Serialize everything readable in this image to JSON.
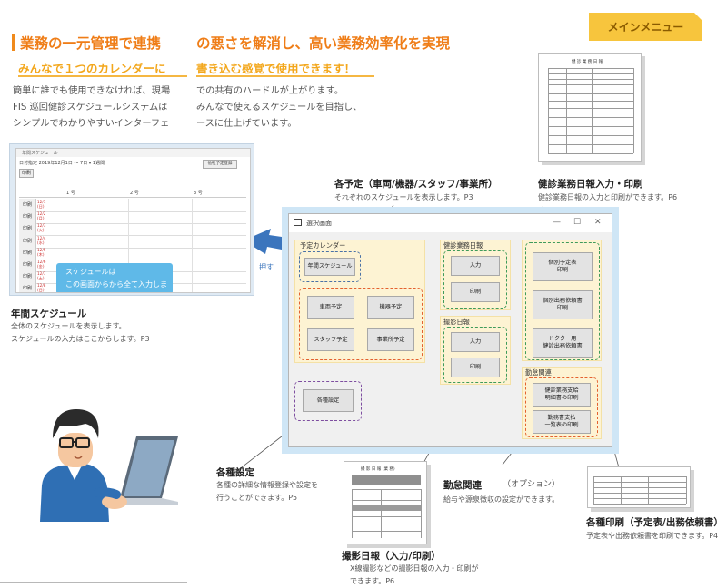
{
  "header": {
    "heading_left": "業務の一元管理で連携",
    "heading_right": "の悪さを解消し、高い業務効率化を実現",
    "subheading_left": "みんなで１つのカレンダーに",
    "subheading_right": "書き込む感覚で使用できます！",
    "intro_left": [
      "簡単に誰でも使用できなければ、現場",
      "FIS 巡回健診スケジュールシステムは",
      "シンプルでわかりやすいインターフェ"
    ],
    "intro_right": [
      "での共有のハードルが上がります。",
      "みんなで使えるスケジュールを目指し、",
      "ースに仕上げています。"
    ]
  },
  "menu_badge": "メインメニュー",
  "annotations": {
    "nenkan": {
      "title": "年間スケジュール",
      "desc": [
        "全体のスケジュールを表示します。",
        "スケジュールの入力はここからします。P3"
      ]
    },
    "kakuyotei": {
      "title": "各予定（車両/機器/スタッフ/事業所）",
      "desc": [
        "それぞれのスケジュールを表示します。P3"
      ]
    },
    "kenshin": {
      "title": "健診業務日報入力・印刷",
      "desc": [
        "健診業務日報の入力と印刷ができます。P6"
      ]
    },
    "settei": {
      "title": "各種設定",
      "desc": [
        "各種の詳細な情報登録や設定を",
        "行うことができます。P5"
      ]
    },
    "satsuei": {
      "title": "撮影日報（入力/印刷）",
      "desc": [
        "X線撮影などの撮影日報の入力・印刷が",
        "できます。P6"
      ]
    },
    "kintai": {
      "title": "勤怠関連",
      "option": "（オプション）",
      "desc": [
        "給与や源泉徴収の設定ができます。"
      ]
    },
    "insatsu": {
      "title": "各種印刷（予定表/出務依頼書）",
      "desc": [
        "予定表や出務依頼書を印刷できます。P4"
      ]
    }
  },
  "calendar_shot": {
    "window_title": "年間スケジュール",
    "toolbar": "日付指定  2019年12月1日  〜  7日 ▾ 1週間",
    "print_button": "印刷",
    "register_button": "他社予定登録",
    "col_headers": [
      "1 号",
      "2 号",
      "3 号"
    ],
    "rows": [
      {
        "head": "印刷",
        "date": "12/1\n(日)"
      },
      {
        "head": "印刷",
        "date": "12/2\n(月)"
      },
      {
        "head": "印刷",
        "date": "12/3\n(火)"
      },
      {
        "head": "印刷",
        "date": "12/4\n(水)"
      },
      {
        "head": "印刷",
        "date": "12/5\n(木)"
      },
      {
        "head": "印刷",
        "date": "12/6\n(金)"
      },
      {
        "head": "印刷",
        "date": "12/7\n(土)"
      },
      {
        "head": "印刷",
        "date": "12/8\n(日)"
      }
    ],
    "tip_lines": [
      "スケジュールは",
      "この画面からから全て入力します"
    ]
  },
  "arrow_label": "押す",
  "main_window": {
    "title": "選択画面",
    "controls": [
      "—",
      "☐",
      "✕"
    ],
    "yotei_group_label": "予定カレンダー",
    "btn_nenkan": "年間スケジュール",
    "btn_sharyo": "車両予定",
    "btn_kiki": "機器予定",
    "btn_staff": "スタッフ予定",
    "btn_jigyosho": "事業所予定",
    "btn_settei": "各種設定",
    "kenshin_label": "健診業務日報",
    "btn_kenshin_input": "入力",
    "btn_kenshin_print": "印刷",
    "satsuei_label": "撮影日報",
    "btn_satsuei_input": "入力",
    "btn_satsuei_print": "印刷",
    "btn_yotei_print": "個別予定表\n印刷",
    "btn_shutsumu_print": "個別出務依頼書\n印刷",
    "btn_doctor_print": "ドクター用\n健診出務依頼書",
    "kintai_label": "勤怠関連",
    "btn_kintai_1": "健診業務支給\n明細書の印刷",
    "btn_kintai_2": "勤務書支払\n一覧表の印刷"
  },
  "doc_kenshin_title": "健 診 業 務 日 報",
  "doc_satsuei_title": "撮 影 日 報 (業 務)",
  "colors": {
    "heading": "#ef7d17",
    "subheading": "#f3a71c",
    "badge": "#f7c53d",
    "window_frame": "#cfe6f6",
    "arrow": "#3b75bd",
    "tip": "#5fb9e8"
  }
}
